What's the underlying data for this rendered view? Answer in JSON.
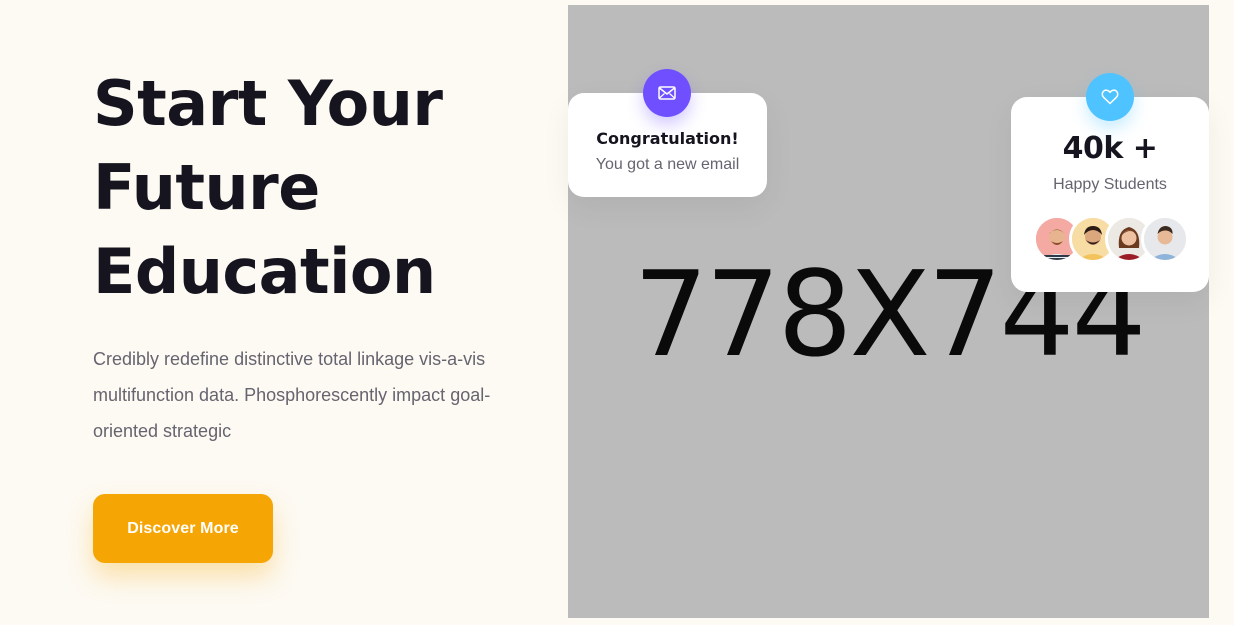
{
  "hero": {
    "title_lines": [
      "Start Your",
      "Future",
      "Education"
    ],
    "description": "Credibly redefine distinctive total linkage vis-a-vis multifunction data. Phosphorescently impact goal-oriented strategic",
    "cta_label": "Discover More"
  },
  "image_placeholder": {
    "text": "778X744"
  },
  "email_card": {
    "icon": "envelope-icon",
    "title": "Congratulation!",
    "subtitle": "You got a new email"
  },
  "students_card": {
    "icon": "heart-icon",
    "value": "40k +",
    "label": "Happy Students",
    "avatars": [
      "avatar-1",
      "avatar-2",
      "avatar-3",
      "avatar-4"
    ]
  },
  "colors": {
    "background": "#fdfaf3",
    "accent": "#f5a504",
    "email_icon_bg": "#6f4fff",
    "heart_icon_bg": "#4fc3ff",
    "heading": "#16151f",
    "body_text": "#66646f",
    "placeholder": "#bbbbbb"
  }
}
